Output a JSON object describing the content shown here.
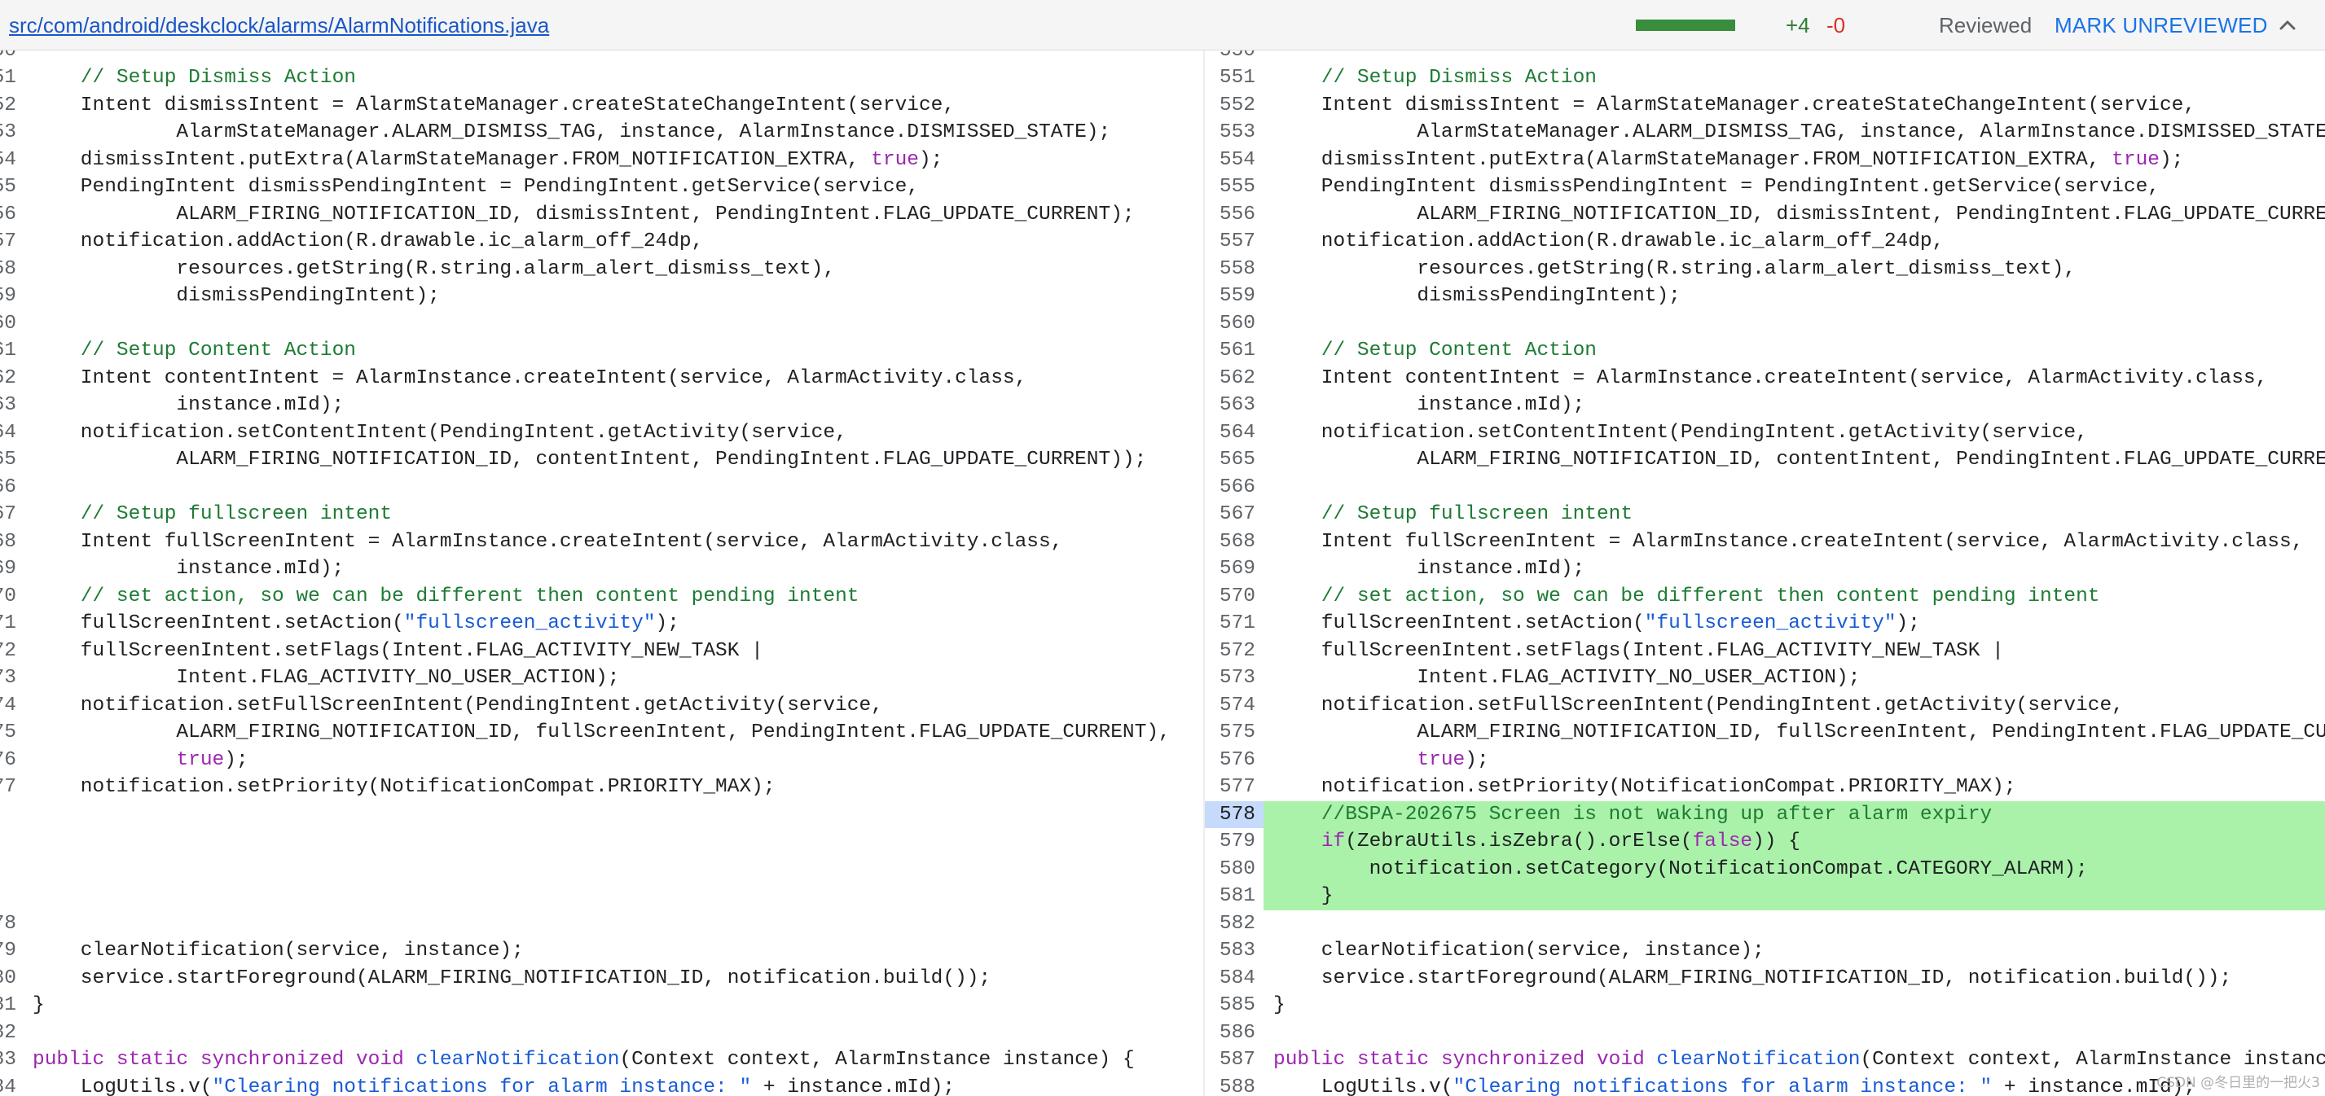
{
  "header": {
    "file_path": "src/com/android/deskclock/alarms/AlarmNotifications.java",
    "progress_fraction": 1.0,
    "added": "+4",
    "removed": "-0",
    "reviewed_label": "Reviewed",
    "mark_button": "MARK UNREVIEWED",
    "collapse_icon": "chevron-up-icon"
  },
  "colors": {
    "added_bg": "#aaf2aa",
    "current_line_bg": "#c6dafc",
    "comment": "#1e7b34",
    "string": "#1a5bd6",
    "keyword": "#9c27b0",
    "link": "#1a73e8",
    "progress": "#388e3c"
  },
  "left_rows": [
    {
      "ln": "50",
      "code": ""
    },
    {
      "ln": "51",
      "code": "    // Setup Dismiss Action"
    },
    {
      "ln": "52",
      "code": "    Intent dismissIntent = AlarmStateManager.createStateChangeIntent(service,"
    },
    {
      "ln": "53",
      "code": "            AlarmStateManager.ALARM_DISMISS_TAG, instance, AlarmInstance.DISMISSED_STATE);"
    },
    {
      "ln": "54",
      "code": "    dismissIntent.putExtra(AlarmStateManager.FROM_NOTIFICATION_EXTRA, true);"
    },
    {
      "ln": "55",
      "code": "    PendingIntent dismissPendingIntent = PendingIntent.getService(service,"
    },
    {
      "ln": "56",
      "code": "            ALARM_FIRING_NOTIFICATION_ID, dismissIntent, PendingIntent.FLAG_UPDATE_CURRENT);"
    },
    {
      "ln": "57",
      "code": "    notification.addAction(R.drawable.ic_alarm_off_24dp,"
    },
    {
      "ln": "58",
      "code": "            resources.getString(R.string.alarm_alert_dismiss_text),"
    },
    {
      "ln": "59",
      "code": "            dismissPendingIntent);"
    },
    {
      "ln": "60",
      "code": ""
    },
    {
      "ln": "61",
      "code": "    // Setup Content Action"
    },
    {
      "ln": "62",
      "code": "    Intent contentIntent = AlarmInstance.createIntent(service, AlarmActivity.class,"
    },
    {
      "ln": "63",
      "code": "            instance.mId);"
    },
    {
      "ln": "64",
      "code": "    notification.setContentIntent(PendingIntent.getActivity(service,"
    },
    {
      "ln": "65",
      "code": "            ALARM_FIRING_NOTIFICATION_ID, contentIntent, PendingIntent.FLAG_UPDATE_CURRENT));"
    },
    {
      "ln": "66",
      "code": ""
    },
    {
      "ln": "67",
      "code": "    // Setup fullscreen intent"
    },
    {
      "ln": "68",
      "code": "    Intent fullScreenIntent = AlarmInstance.createIntent(service, AlarmActivity.class,"
    },
    {
      "ln": "69",
      "code": "            instance.mId);"
    },
    {
      "ln": "70",
      "code": "    // set action, so we can be different then content pending intent"
    },
    {
      "ln": "71",
      "code": "    fullScreenIntent.setAction(\"fullscreen_activity\");"
    },
    {
      "ln": "72",
      "code": "    fullScreenIntent.setFlags(Intent.FLAG_ACTIVITY_NEW_TASK |"
    },
    {
      "ln": "73",
      "code": "            Intent.FLAG_ACTIVITY_NO_USER_ACTION);"
    },
    {
      "ln": "74",
      "code": "    notification.setFullScreenIntent(PendingIntent.getActivity(service,"
    },
    {
      "ln": "75",
      "code": "            ALARM_FIRING_NOTIFICATION_ID, fullScreenIntent, PendingIntent.FLAG_UPDATE_CURRENT),"
    },
    {
      "ln": "76",
      "code": "            true);"
    },
    {
      "ln": "77",
      "code": "    notification.setPriority(NotificationCompat.PRIORITY_MAX);"
    },
    {
      "ln": "",
      "code": ""
    },
    {
      "ln": "",
      "code": ""
    },
    {
      "ln": "",
      "code": ""
    },
    {
      "ln": "",
      "code": ""
    },
    {
      "ln": "78",
      "code": ""
    },
    {
      "ln": "79",
      "code": "    clearNotification(service, instance);"
    },
    {
      "ln": "80",
      "code": "    service.startForeground(ALARM_FIRING_NOTIFICATION_ID, notification.build());"
    },
    {
      "ln": "81",
      "code": "}"
    },
    {
      "ln": "82",
      "code": ""
    },
    {
      "ln": "83",
      "code": "public static synchronized void clearNotification(Context context, AlarmInstance instance) {"
    },
    {
      "ln": "84",
      "code": "    LogUtils.v(\"Clearing notifications for alarm instance: \" + instance.mId);"
    }
  ],
  "right_rows": [
    {
      "ln": "550",
      "code": ""
    },
    {
      "ln": "551",
      "code": "    // Setup Dismiss Action"
    },
    {
      "ln": "552",
      "code": "    Intent dismissIntent = AlarmStateManager.createStateChangeIntent(service,"
    },
    {
      "ln": "553",
      "code": "            AlarmStateManager.ALARM_DISMISS_TAG, instance, AlarmInstance.DISMISSED_STATE);"
    },
    {
      "ln": "554",
      "code": "    dismissIntent.putExtra(AlarmStateManager.FROM_NOTIFICATION_EXTRA, true);"
    },
    {
      "ln": "555",
      "code": "    PendingIntent dismissPendingIntent = PendingIntent.getService(service,"
    },
    {
      "ln": "556",
      "code": "            ALARM_FIRING_NOTIFICATION_ID, dismissIntent, PendingIntent.FLAG_UPDATE_CURRENT);"
    },
    {
      "ln": "557",
      "code": "    notification.addAction(R.drawable.ic_alarm_off_24dp,"
    },
    {
      "ln": "558",
      "code": "            resources.getString(R.string.alarm_alert_dismiss_text),"
    },
    {
      "ln": "559",
      "code": "            dismissPendingIntent);"
    },
    {
      "ln": "560",
      "code": ""
    },
    {
      "ln": "561",
      "code": "    // Setup Content Action"
    },
    {
      "ln": "562",
      "code": "    Intent contentIntent = AlarmInstance.createIntent(service, AlarmActivity.class,"
    },
    {
      "ln": "563",
      "code": "            instance.mId);"
    },
    {
      "ln": "564",
      "code": "    notification.setContentIntent(PendingIntent.getActivity(service,"
    },
    {
      "ln": "565",
      "code": "            ALARM_FIRING_NOTIFICATION_ID, contentIntent, PendingIntent.FLAG_UPDATE_CURRENT));"
    },
    {
      "ln": "566",
      "code": ""
    },
    {
      "ln": "567",
      "code": "    // Setup fullscreen intent"
    },
    {
      "ln": "568",
      "code": "    Intent fullScreenIntent = AlarmInstance.createIntent(service, AlarmActivity.class,"
    },
    {
      "ln": "569",
      "code": "            instance.mId);"
    },
    {
      "ln": "570",
      "code": "    // set action, so we can be different then content pending intent"
    },
    {
      "ln": "571",
      "code": "    fullScreenIntent.setAction(\"fullscreen_activity\");"
    },
    {
      "ln": "572",
      "code": "    fullScreenIntent.setFlags(Intent.FLAG_ACTIVITY_NEW_TASK |"
    },
    {
      "ln": "573",
      "code": "            Intent.FLAG_ACTIVITY_NO_USER_ACTION);"
    },
    {
      "ln": "574",
      "code": "    notification.setFullScreenIntent(PendingIntent.getActivity(service,"
    },
    {
      "ln": "575",
      "code": "            ALARM_FIRING_NOTIFICATION_ID, fullScreenIntent, PendingIntent.FLAG_UPDATE_CURRENT),"
    },
    {
      "ln": "576",
      "code": "            true);"
    },
    {
      "ln": "577",
      "code": "    notification.setPriority(NotificationCompat.PRIORITY_MAX);"
    },
    {
      "ln": "578",
      "code": "    //BSPA-202675 Screen is not waking up after alarm expiry",
      "add": true,
      "current": true
    },
    {
      "ln": "579",
      "code": "    if(ZebraUtils.isZebra().orElse(false)) {",
      "add": true
    },
    {
      "ln": "580",
      "code": "        notification.setCategory(NotificationCompat.CATEGORY_ALARM);",
      "add": true
    },
    {
      "ln": "581",
      "code": "    }",
      "add": true
    },
    {
      "ln": "582",
      "code": ""
    },
    {
      "ln": "583",
      "code": "    clearNotification(service, instance);"
    },
    {
      "ln": "584",
      "code": "    service.startForeground(ALARM_FIRING_NOTIFICATION_ID, notification.build());"
    },
    {
      "ln": "585",
      "code": "}"
    },
    {
      "ln": "586",
      "code": ""
    },
    {
      "ln": "587",
      "code": "public static synchronized void clearNotification(Context context, AlarmInstance instance) {"
    },
    {
      "ln": "588",
      "code": "    LogUtils.v(\"Clearing notifications for alarm instance: \" + instance.mId);"
    }
  ],
  "watermark": "CSDN @冬日里的一把火3"
}
